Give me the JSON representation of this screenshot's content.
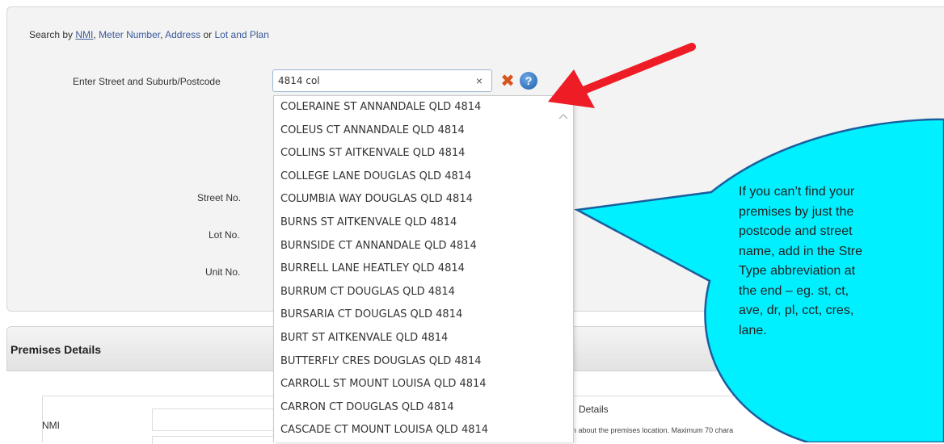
{
  "search_by": {
    "prefix": "Search by",
    "links": [
      "NMI",
      "Meter Number",
      "Address",
      "Lot and Plan"
    ],
    "sep_comma": ",",
    "sep_or": "or"
  },
  "form": {
    "street_label": "Enter Street and Suburb/Postcode",
    "street_value": "4814 col",
    "street_no_label": "Street No.",
    "lot_no_label": "Lot No.",
    "unit_no_label": "Unit No."
  },
  "icons": {
    "clear_input": "×",
    "clear_button": "✖",
    "help_button": "?"
  },
  "dropdown": {
    "items": [
      "COLERAINE ST ANNANDALE QLD 4814",
      "COLEUS CT ANNANDALE QLD 4814",
      "COLLINS ST AITKENVALE QLD 4814",
      "COLLEGE LANE DOUGLAS QLD 4814",
      "COLUMBIA WAY DOUGLAS QLD 4814",
      "BURNS ST AITKENVALE QLD 4814",
      "BURNSIDE CT ANNANDALE QLD 4814",
      "BURRELL LANE HEATLEY QLD 4814",
      "BURRUM CT DOUGLAS QLD 4814",
      "BURSARIA CT DOUGLAS QLD 4814",
      "BURT ST AITKENVALE QLD 4814",
      "BUTTERFLY CRES DOUGLAS QLD 4814",
      "CARROLL ST MOUNT LOUISA QLD 4814",
      "CARRON CT DOUGLAS QLD 4814",
      "CASCADE CT MOUNT LOUISA QLD 4814"
    ]
  },
  "premises": {
    "title": "Premises Details",
    "nmi_label": "NMI",
    "details_label": "Details",
    "details_note": "n about the premises location. Maximum 70 chara"
  },
  "callout": {
    "lines": [
      "If you can’t find your",
      "premises by just the",
      "postcode and street",
      "name, add in the Stre",
      "Type abbreviation at",
      "the end – eg. st, ct,",
      "ave, dr, pl, cct, cres,",
      "lane."
    ]
  },
  "colors": {
    "callout_fill": "#00f0ff",
    "arrow": "#ee1c25",
    "link": "#3b5a9a",
    "clear_button": "#d9531e",
    "help_button": "#1c5fae"
  }
}
